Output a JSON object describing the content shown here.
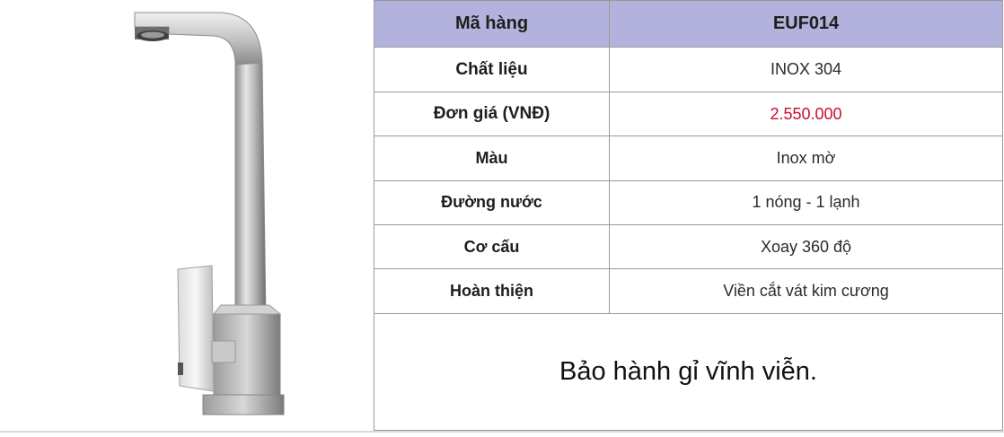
{
  "image": {
    "alt": "",
    "icon": "faucet-icon"
  },
  "table": {
    "header": {
      "label": "Mã hàng",
      "value": "EUF014"
    },
    "rows": [
      {
        "label": "Chất liệu",
        "value": "INOX 304"
      },
      {
        "label": "Đơn giá (VNĐ)",
        "value": "2.550.000"
      },
      {
        "label": "Màu",
        "value": "Inox mờ"
      },
      {
        "label": "Đường nước",
        "value": "1 nóng - 1 lạnh"
      },
      {
        "label": "Cơ cấu",
        "value": "Xoay 360 độ"
      },
      {
        "label": "Hoàn thiện",
        "value": "Viền cắt vát kim cương"
      }
    ],
    "warranty": "Bảo hành gỉ vĩnh viễn."
  },
  "colors": {
    "header_bg": "#b3b2dc",
    "price": "#c8102e",
    "border": "#9a9a9a"
  }
}
